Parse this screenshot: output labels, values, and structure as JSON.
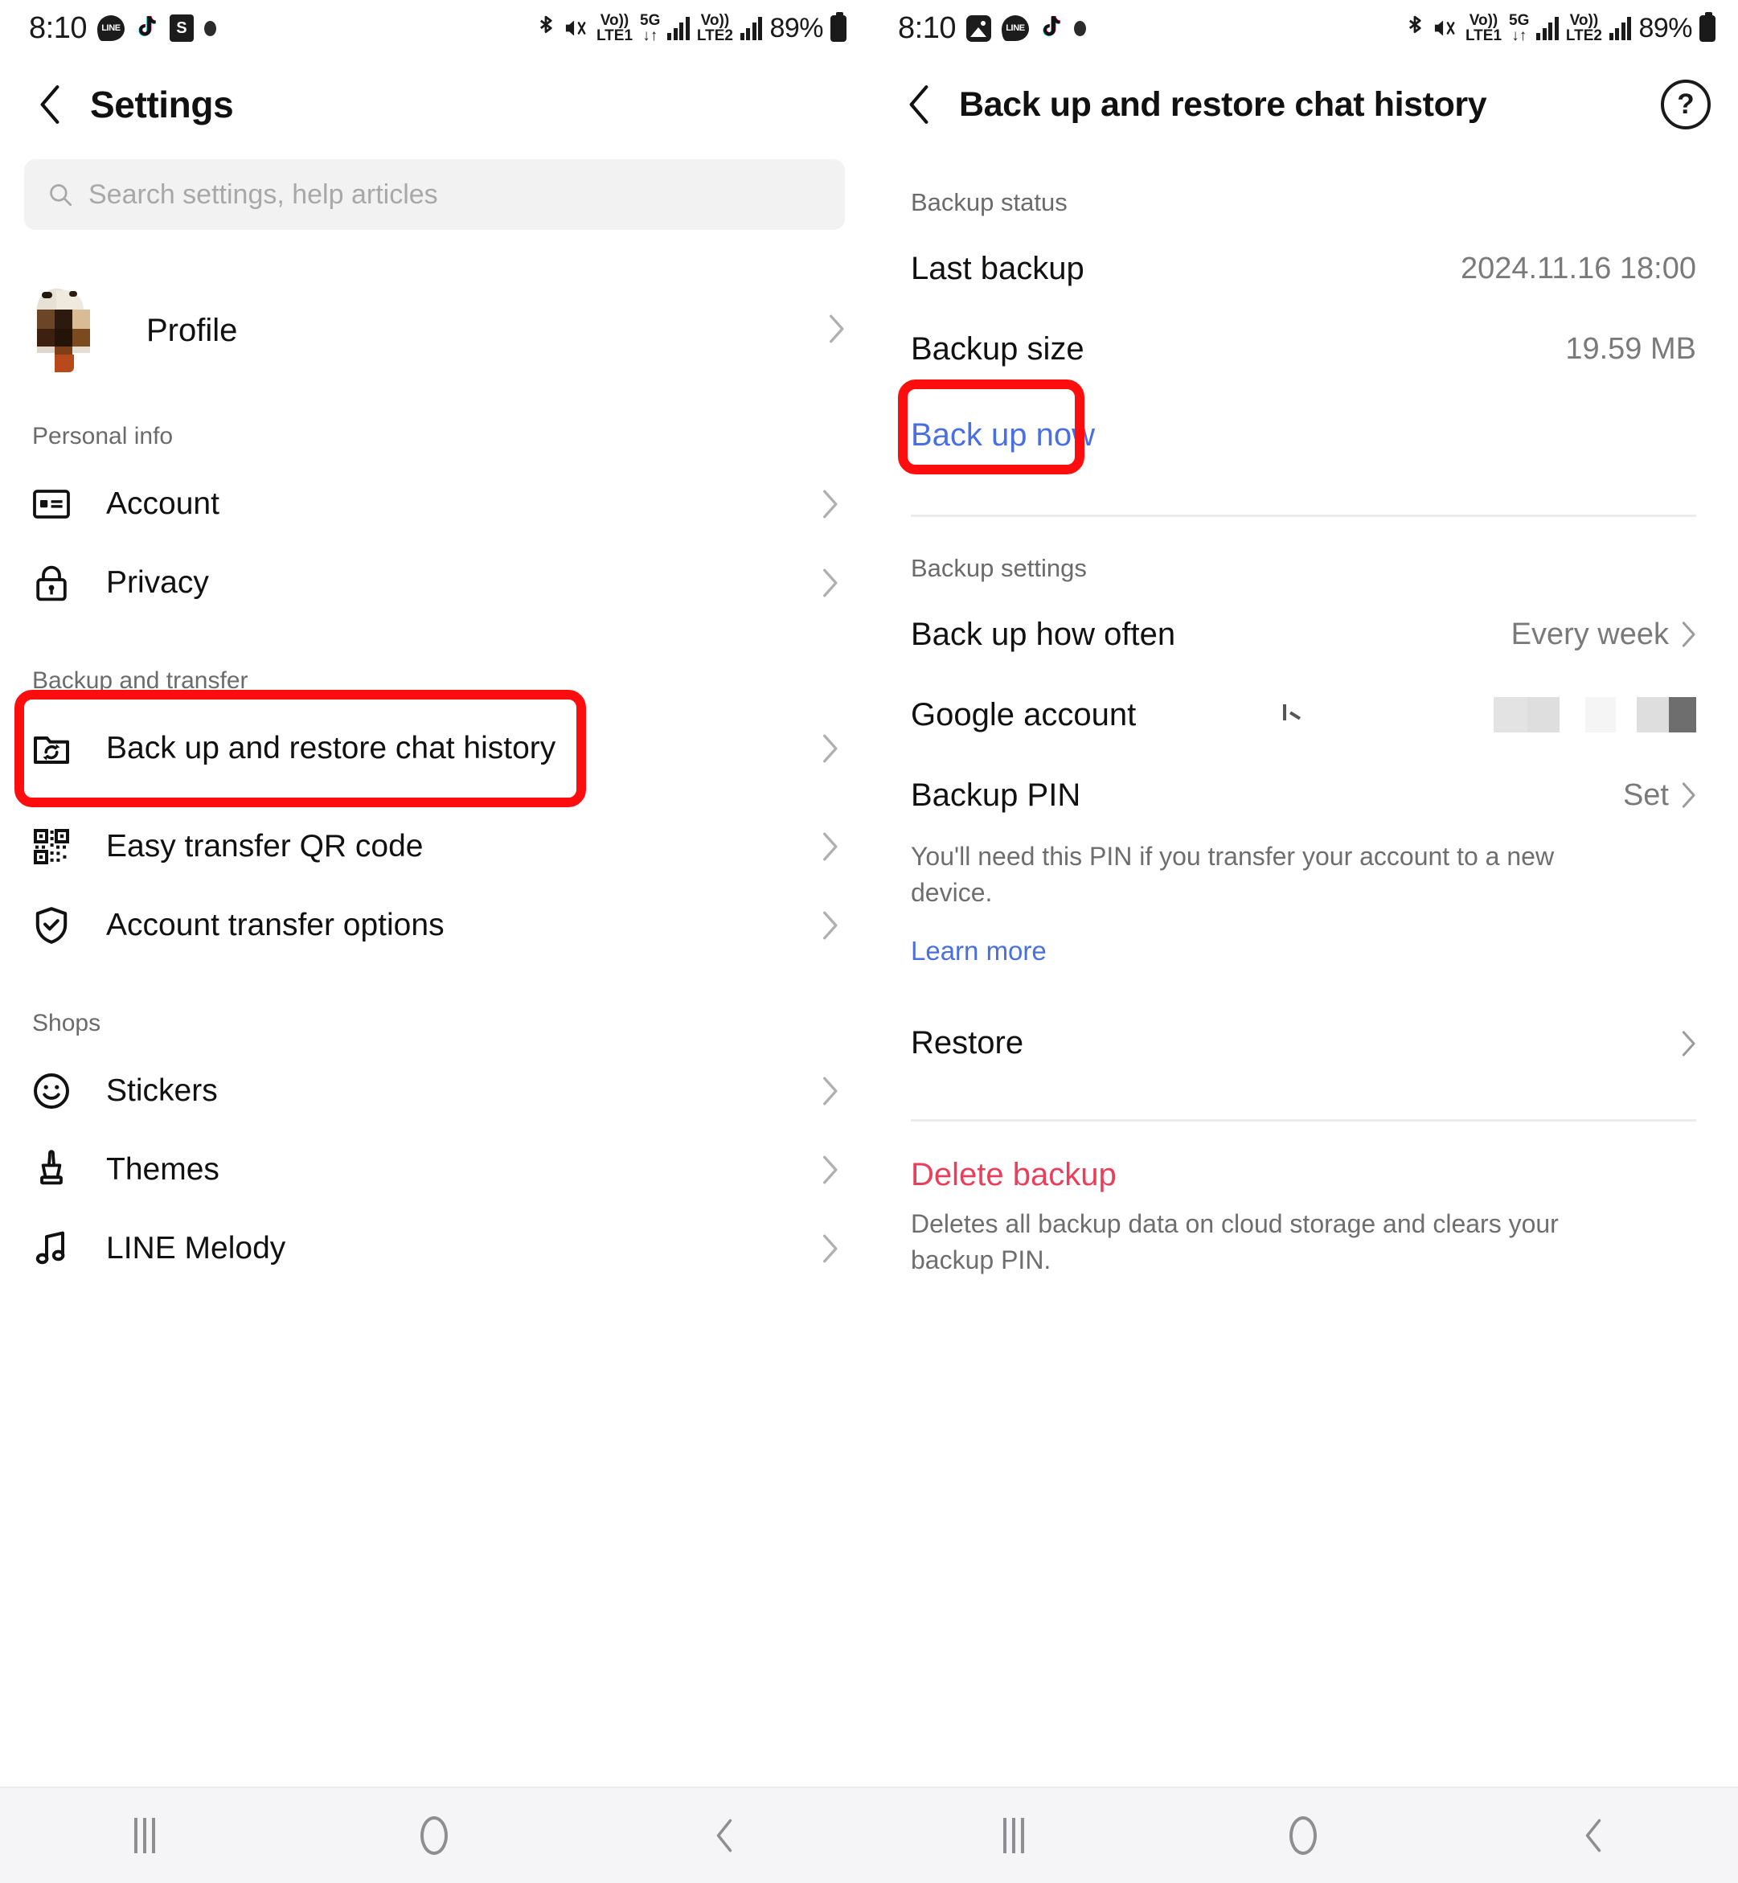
{
  "status_bar_left": {
    "time": "8:10",
    "app_icons": [
      "line-icon",
      "tiktok-icon",
      "shopee-icon",
      "dot-icon"
    ],
    "bluetooth": "bluetooth-icon",
    "mute": "mute-vibrate-icon",
    "volte1_top": "Vo))",
    "volte1_bottom": "LTE1",
    "network_top": "5G",
    "network_bottom": "↓↑",
    "volte2_top": "Vo))",
    "volte2_bottom": "LTE2",
    "battery": "89%"
  },
  "status_bar_right": {
    "time": "8:10",
    "app_icons": [
      "gallery-icon",
      "line-icon",
      "tiktok-icon",
      "dot-icon"
    ],
    "volte1_top": "Vo))",
    "volte1_bottom": "LTE1",
    "network_top": "5G",
    "network_bottom": "↓↑",
    "volte2_top": "Vo))",
    "volte2_bottom": "LTE2",
    "battery": "89%"
  },
  "left_screen": {
    "title": "Settings",
    "back_icon": "chevron-left-icon",
    "search": {
      "placeholder": "Search settings, help articles",
      "icon": "search-icon"
    },
    "profile": {
      "label": "Profile",
      "avatar": "profile-avatar-redacted"
    },
    "sections": [
      {
        "heading": "Personal info",
        "items": [
          {
            "label": "Account",
            "icon": "id-card-icon"
          },
          {
            "label": "Privacy",
            "icon": "lock-icon"
          }
        ]
      },
      {
        "heading": "Backup and transfer",
        "items": [
          {
            "label": "Back up and restore chat history",
            "icon": "folder-sync-icon",
            "highlighted": true
          },
          {
            "label": "Easy transfer QR code",
            "icon": "qr-code-icon"
          },
          {
            "label": "Account transfer options",
            "icon": "shield-check-icon"
          }
        ]
      },
      {
        "heading": "Shops",
        "items": [
          {
            "label": "Stickers",
            "icon": "smiley-face-icon"
          },
          {
            "label": "Themes",
            "icon": "paint-brush-icon"
          },
          {
            "label": "LINE Melody",
            "icon": "music-note-icon"
          }
        ]
      }
    ]
  },
  "right_screen": {
    "title": "Back up and restore chat history",
    "back_icon": "chevron-left-icon",
    "help_icon": "help-question-icon",
    "backup_status": {
      "heading": "Backup status",
      "last_backup_label": "Last backup",
      "last_backup_value": "2024.11.16 18:00",
      "backup_size_label": "Backup size",
      "backup_size_value": "19.59 MB",
      "back_up_now": "Back up now",
      "back_up_now_highlighted": true
    },
    "backup_settings": {
      "heading": "Backup settings",
      "how_often_label": "Back up how often",
      "how_often_value": "Every week",
      "google_account_label": "Google account",
      "google_account_value": "",
      "backup_pin_label": "Backup PIN",
      "backup_pin_value": "Set",
      "backup_pin_desc": "You'll need this PIN if you transfer your account to a new device.",
      "learn_more": "Learn more",
      "restore_label": "Restore"
    },
    "delete": {
      "label": "Delete backup",
      "desc": "Deletes all backup data on cloud storage and clears your backup PIN."
    }
  },
  "nav_bar": {
    "recents": "recents-icon",
    "home": "home-icon",
    "back": "back-icon"
  },
  "colors": {
    "highlight_red": "#fd0d0d",
    "link_blue": "#4a6fe0",
    "danger_red": "#e8405c",
    "muted_gray": "#6e6e6e"
  }
}
